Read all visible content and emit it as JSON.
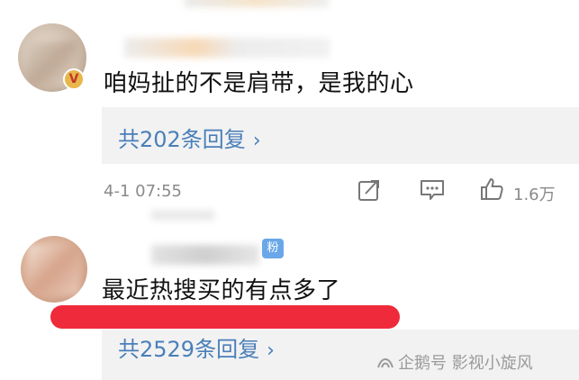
{
  "comments": [
    {
      "text": "咱妈扯的不是肩带，是我的心",
      "replies_label": "共202条回复",
      "badge": "V",
      "time": "4-1 07:55",
      "like_count": "1.6万"
    },
    {
      "text": "最近热搜买的有点多了",
      "replies_label": "共2529条回复",
      "fan_badge": "粉"
    }
  ],
  "icons": {
    "chevron": "›",
    "share": "share-icon",
    "comment": "comment-icon",
    "like": "thumbs-up-icon"
  },
  "watermark": "企鹅号 影视小旋风",
  "colors": {
    "link": "#4a7fb8",
    "highlight": "#ef2a3a",
    "reply_bg": "#f2f2f3"
  }
}
